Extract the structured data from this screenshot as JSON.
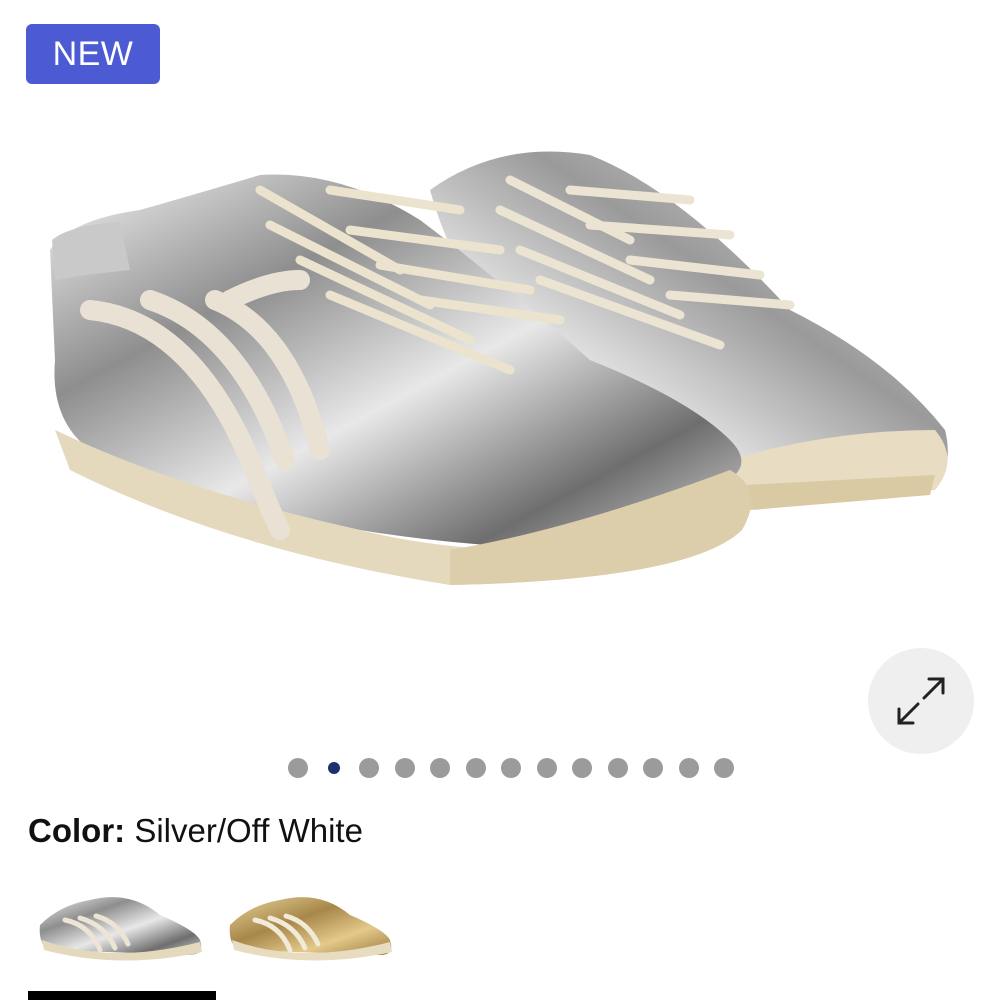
{
  "badge": {
    "label": "NEW"
  },
  "product_image": {
    "description_icon": "shoe-image"
  },
  "gallery": {
    "dot_count": 13,
    "active_index": 1
  },
  "color": {
    "label": "Color:",
    "value": "Silver/Off White"
  },
  "swatches": [
    {
      "name": "silver-off-white-swatch",
      "selected": true
    },
    {
      "name": "gold-off-white-swatch",
      "selected": false
    }
  ],
  "colors": {
    "badge_bg": "#4c5bd4",
    "active_dot": "#1f2f6e",
    "inactive_dot": "#9b9b9b"
  }
}
